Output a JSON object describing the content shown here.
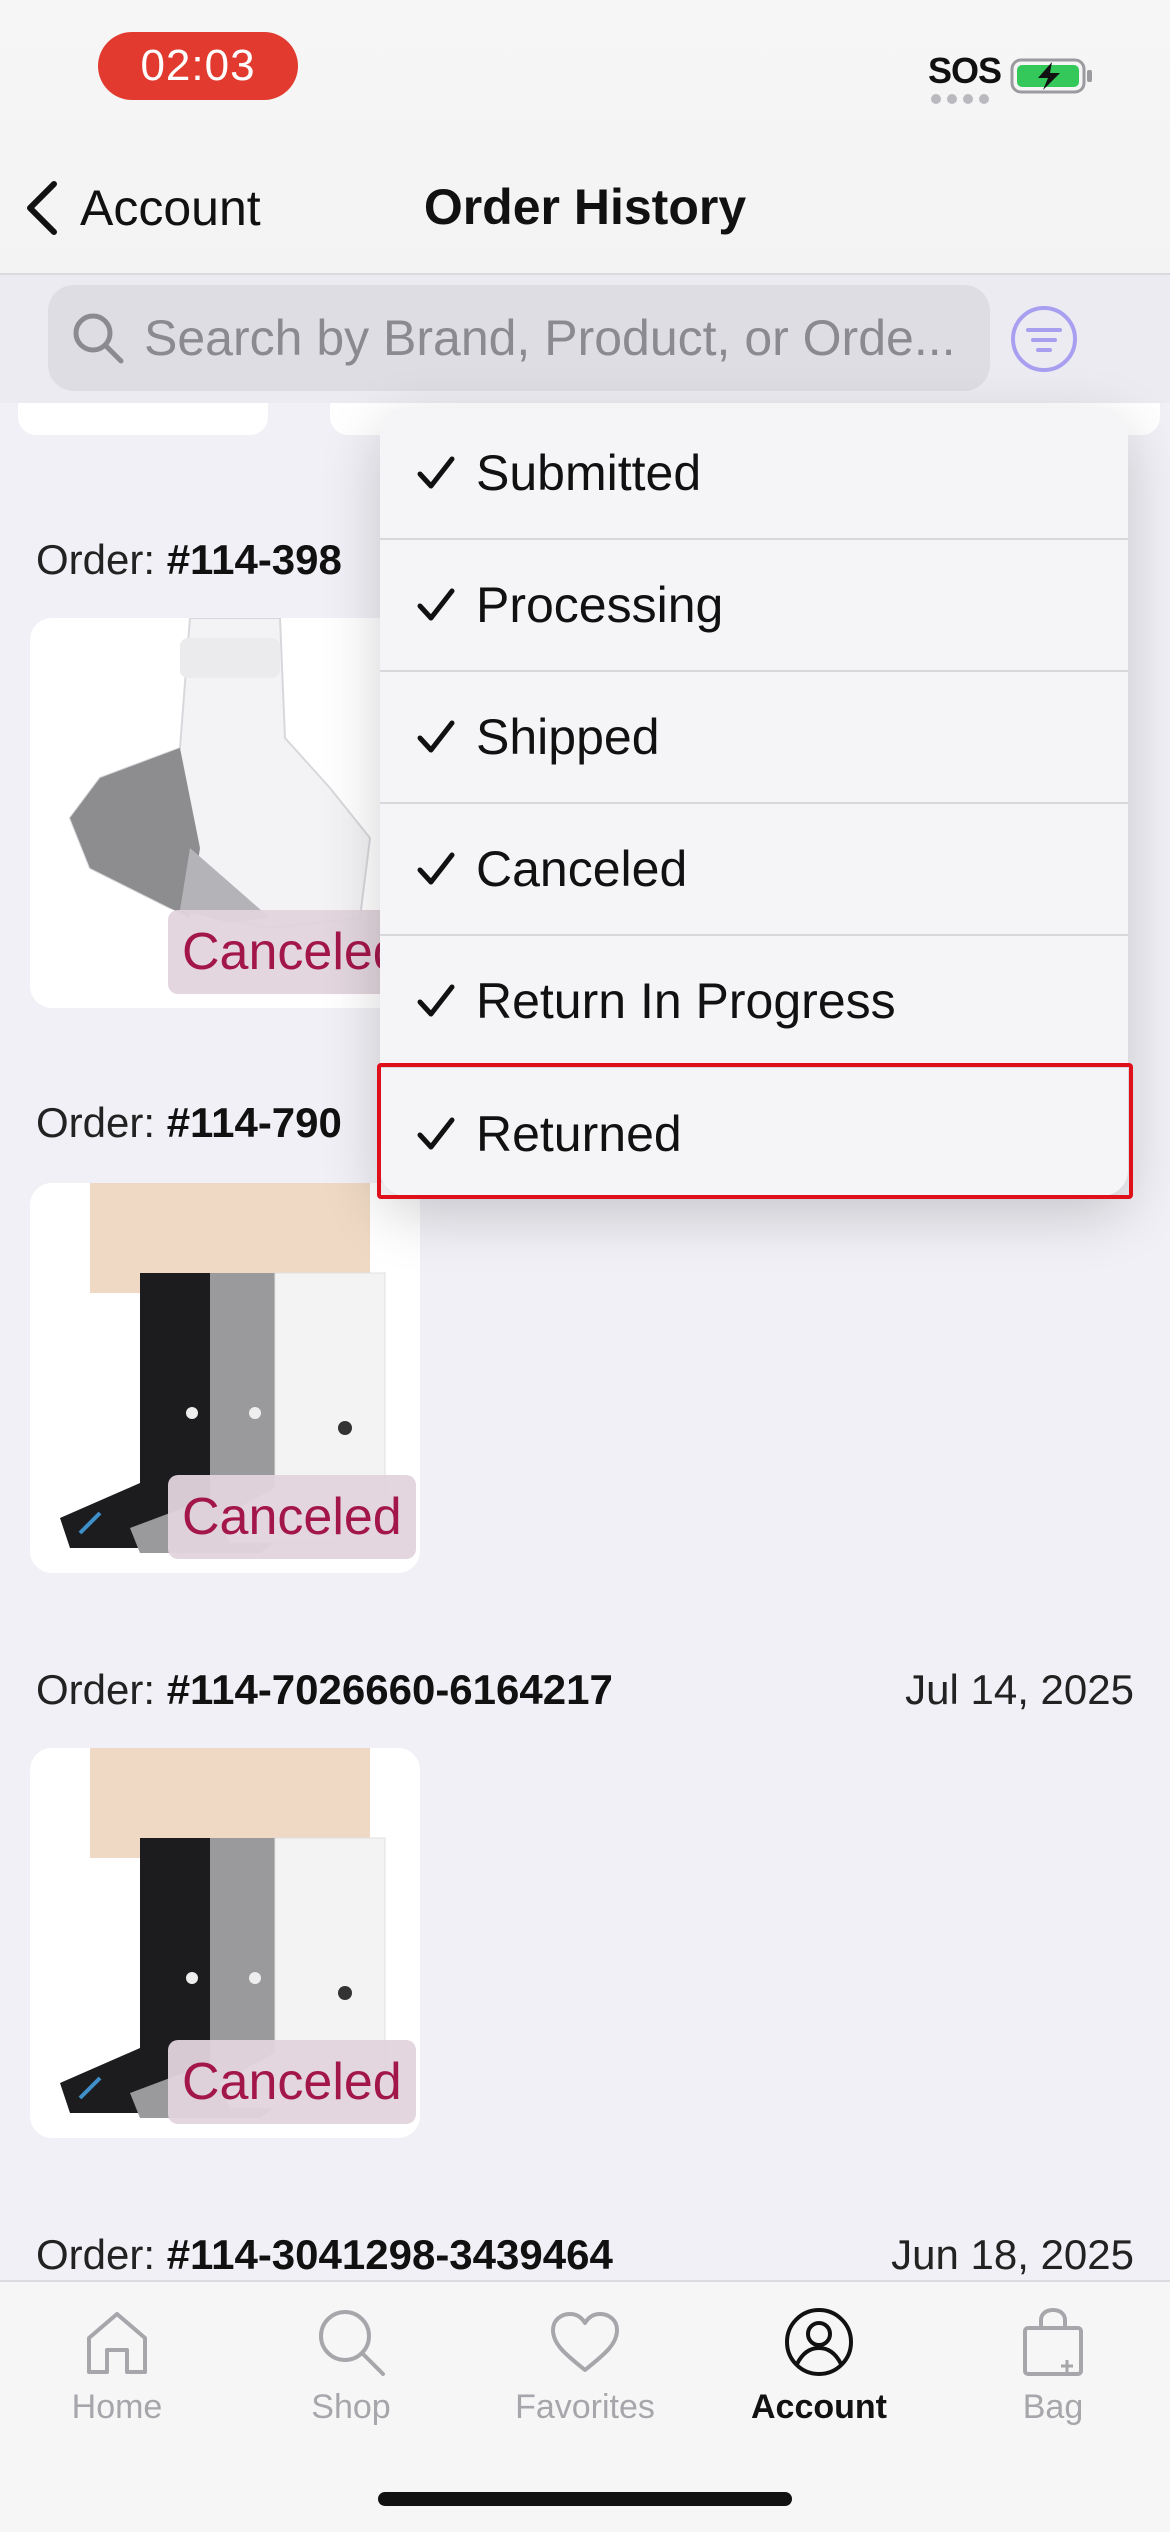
{
  "status_bar": {
    "time": "02:03",
    "sos": "SOS"
  },
  "nav": {
    "back_label": "Account",
    "title": "Order History"
  },
  "search": {
    "placeholder": "Search by Brand, Product, or Orde..."
  },
  "orders": [
    {
      "label": "Order:",
      "number": "#114-398",
      "date": "",
      "status": "Canceled",
      "product": "features-ankle-sock-white-gray"
    },
    {
      "label": "Order:",
      "number": "#114-790",
      "date": "",
      "status": "Canceled",
      "product": "stance-crew-socks-3pack"
    },
    {
      "label": "Order:",
      "number": "#114-7026660-6164217",
      "date": "Jul 14, 2025",
      "status": "Canceled",
      "product": "stance-crew-socks-3pack"
    },
    {
      "label": "Order:",
      "number": "#114-3041298-3439464",
      "date": "Jun 18, 2025"
    }
  ],
  "filter_menu": {
    "items": [
      {
        "label": "Submitted",
        "checked": true
      },
      {
        "label": "Processing",
        "checked": true
      },
      {
        "label": "Shipped",
        "checked": true
      },
      {
        "label": "Canceled",
        "checked": true
      },
      {
        "label": "Return In Progress",
        "checked": true
      },
      {
        "label": "Returned",
        "checked": true,
        "highlighted": true
      }
    ]
  },
  "tabs": [
    {
      "label": "Home",
      "icon": "home-icon",
      "active": false
    },
    {
      "label": "Shop",
      "icon": "search-icon",
      "active": false
    },
    {
      "label": "Favorites",
      "icon": "heart-icon",
      "active": false
    },
    {
      "label": "Account",
      "icon": "person-icon",
      "active": true
    },
    {
      "label": "Bag",
      "icon": "bag-icon",
      "active": false
    }
  ],
  "colors": {
    "status_time_bg": "#e23a2f",
    "canceled_text": "#a3164a",
    "highlight_border": "#e0101a",
    "filter_icon": "#a89ff0",
    "battery_fill": "#34c759"
  }
}
